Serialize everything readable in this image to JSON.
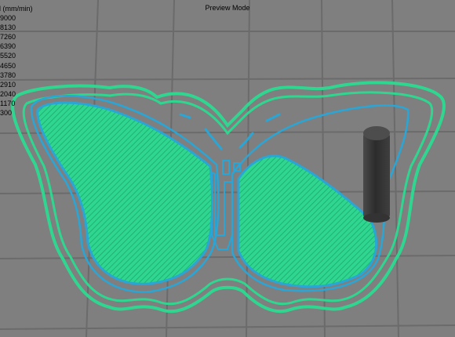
{
  "header": {
    "mode_label": "Preview Mode"
  },
  "legend": {
    "title": "ed (mm/min)",
    "values": [
      "9000",
      "8130",
      "7260",
      "6390",
      "5520",
      "4650",
      "3780",
      "2910",
      "2040",
      "1170",
      "300"
    ]
  },
  "colors": {
    "background": "#7f7f7f",
    "grid_line": "#6b6b6b",
    "skirt_outline": "#2fd690",
    "wall_outline": "#29a6d6",
    "infill": "#2fd690",
    "infill_line": "#1ea86c",
    "tool_head": "#3c3c3c"
  },
  "icons": {
    "tool_head": "nozzle-cylinder-icon"
  }
}
